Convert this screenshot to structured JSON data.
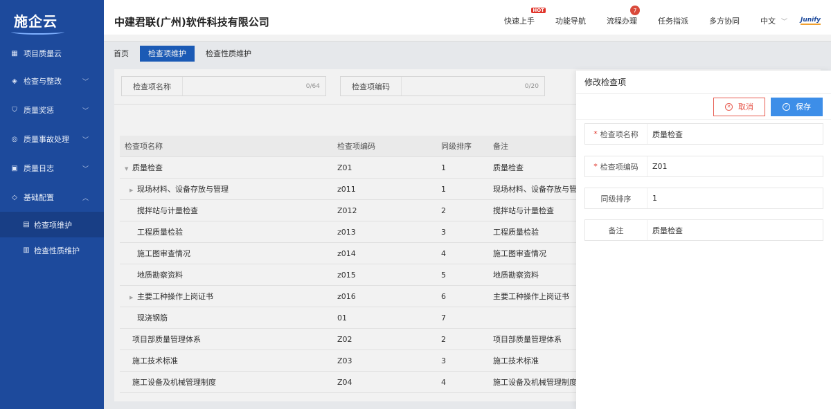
{
  "app": {
    "logo_text": "施企云",
    "company": "中建君联(广州)软件科技有限公司"
  },
  "sidebar": {
    "items": [
      {
        "label": "项目质量云",
        "icon": "grid-icon"
      },
      {
        "label": "检查与整改",
        "icon": "cube-icon"
      },
      {
        "label": "质量奖惩",
        "icon": "shield-icon"
      },
      {
        "label": "质量事故处理",
        "icon": "target-icon"
      },
      {
        "label": "质量日志",
        "icon": "log-icon"
      },
      {
        "label": "基础配置",
        "icon": "layers-icon"
      }
    ],
    "sub_items": [
      {
        "label": "检查项维护",
        "icon": "building-icon"
      },
      {
        "label": "检查性质维护",
        "icon": "chip-icon"
      }
    ]
  },
  "topnav": {
    "quick_start": "快速上手",
    "hot": "HOT",
    "func_nav": "功能导航",
    "process": "流程办理",
    "process_badge": "7",
    "task": "任务指派",
    "collab": "多方协同",
    "lang": "中文",
    "brand": "Junify"
  },
  "tabs": [
    "首页",
    "检查项维护",
    "检查性质维护"
  ],
  "filters": [
    {
      "label": "检查项名称",
      "count": "0/64"
    },
    {
      "label": "检查项编码",
      "count": "0/20"
    }
  ],
  "table": {
    "headers": [
      "检查项名称",
      "检查项编码",
      "同级排序",
      "备注"
    ],
    "rows": [
      {
        "name": "质量检查",
        "code": "Z01",
        "order": "1",
        "note": "质量检查"
      },
      {
        "name": "现场材料、设备存放与管理",
        "code": "z011",
        "order": "1",
        "note": "现场材料、设备存放与管"
      },
      {
        "name": "搅拌站与计量检查",
        "code": "Z012",
        "order": "2",
        "note": "搅拌站与计量检查"
      },
      {
        "name": "工程质量检验",
        "code": "z013",
        "order": "3",
        "note": "工程质量检验"
      },
      {
        "name": "施工图审查情况",
        "code": "z014",
        "order": "4",
        "note": "施工图审查情况"
      },
      {
        "name": "地质勘察资料",
        "code": "z015",
        "order": "5",
        "note": "地质勘察资料"
      },
      {
        "name": "主要工种操作上岗证书",
        "code": "z016",
        "order": "6",
        "note": "主要工种操作上岗证书"
      },
      {
        "name": "现浇钢筋",
        "code": "01",
        "order": "7",
        "note": ""
      },
      {
        "name": "项目部质量管理体系",
        "code": "Z02",
        "order": "2",
        "note": "项目部质量管理体系"
      },
      {
        "name": "施工技术标准",
        "code": "Z03",
        "order": "3",
        "note": "施工技术标准"
      },
      {
        "name": "施工设备及机械管理制度",
        "code": "Z04",
        "order": "4",
        "note": "施工设备及机械管理制度"
      }
    ]
  },
  "drawer": {
    "title": "修改检查项",
    "cancel": "取消",
    "save": "保存",
    "fields": [
      {
        "label": "检查项名称",
        "value": "质量检查",
        "required": true
      },
      {
        "label": "检查项编码",
        "value": "Z01",
        "required": true
      },
      {
        "label": "同级排序",
        "value": "1",
        "required": false
      },
      {
        "label": "备注",
        "value": "质量检查",
        "required": false
      }
    ],
    "required_mark": "*"
  },
  "colors": {
    "sidebar": "#1d4a9c",
    "primary": "#3d8ee8",
    "danger": "#e75a4f"
  }
}
